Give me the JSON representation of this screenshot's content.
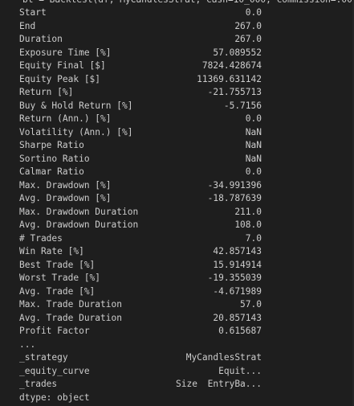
{
  "header_cut": "bt = Backtest(df, MyCandlesStrat, cash=10_000, commission=.00",
  "stats": [
    {
      "key": "Start",
      "value": "0.0"
    },
    {
      "key": "End",
      "value": "267.0"
    },
    {
      "key": "Duration",
      "value": "267.0"
    },
    {
      "key": "Exposure Time [%]",
      "value": "57.089552"
    },
    {
      "key": "Equity Final [$]",
      "value": "7824.428674"
    },
    {
      "key": "Equity Peak [$]",
      "value": "11369.631142"
    },
    {
      "key": "Return [%]",
      "value": "-21.755713"
    },
    {
      "key": "Buy & Hold Return [%]",
      "value": "-5.7156"
    },
    {
      "key": "Return (Ann.) [%]",
      "value": "0.0"
    },
    {
      "key": "Volatility (Ann.) [%]",
      "value": "NaN"
    },
    {
      "key": "Sharpe Ratio",
      "value": "NaN"
    },
    {
      "key": "Sortino Ratio",
      "value": "NaN"
    },
    {
      "key": "Calmar Ratio",
      "value": "0.0"
    },
    {
      "key": "Max. Drawdown [%]",
      "value": "-34.991396"
    },
    {
      "key": "Avg. Drawdown [%]",
      "value": "-18.787639"
    },
    {
      "key": "Max. Drawdown Duration",
      "value": "211.0"
    },
    {
      "key": "Avg. Drawdown Duration",
      "value": "108.0"
    },
    {
      "key": "# Trades",
      "value": "7.0"
    },
    {
      "key": "Win Rate [%]",
      "value": "42.857143"
    },
    {
      "key": "Best Trade [%]",
      "value": "15.914914"
    },
    {
      "key": "Worst Trade [%]",
      "value": "-19.355039"
    },
    {
      "key": "Avg. Trade [%]",
      "value": "-4.671989"
    },
    {
      "key": "Max. Trade Duration",
      "value": "57.0"
    },
    {
      "key": "Avg. Trade Duration",
      "value": "20.857143"
    },
    {
      "key": "Profit Factor",
      "value": "0.615687"
    },
    {
      "key": "...",
      "value": ""
    },
    {
      "key": "_strategy",
      "value": "MyCandlesStrat"
    },
    {
      "key": "_equity_curve",
      "value": "Equit..."
    },
    {
      "key": "_trades",
      "value": "EntryBa...",
      "extra": "Size"
    },
    {
      "key": "dtype: object",
      "value": ""
    }
  ]
}
